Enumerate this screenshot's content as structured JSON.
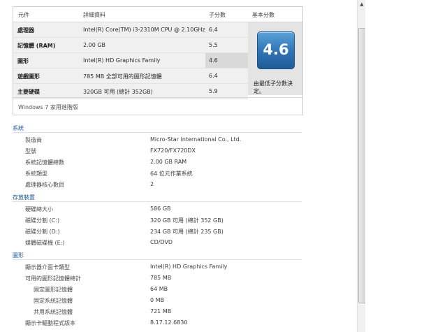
{
  "score_table": {
    "headers": {
      "component": "元件",
      "details": "詳細資料",
      "subscore": "子分數",
      "base_score": "基本分數"
    },
    "rows": [
      {
        "component": "處理器",
        "detail": "Intel(R) Core(TM) i3-2310M CPU @ 2.10GHz",
        "score": "6.4"
      },
      {
        "component": "記憶體 (RAM)",
        "detail": "2.00 GB",
        "score": "5.5"
      },
      {
        "component": "圖形",
        "detail": "Intel(R) HD Graphics Family",
        "score": "4.6"
      },
      {
        "component": "遊戲圖形",
        "detail": "785 MB 全部可用的圖形記憶體",
        "score": "6.4"
      },
      {
        "component": "主要硬碟",
        "detail": "320GB 可用 (總計 352GB)",
        "score": "5.9"
      }
    ],
    "base_score": "4.6",
    "base_note": "由最低子分數決定。",
    "edition": "Windows 7 家用進階版"
  },
  "sections": {
    "system": {
      "title": "系統",
      "rows": [
        {
          "label": "製造商",
          "value": "Micro-Star International Co., Ltd."
        },
        {
          "label": "型號",
          "value": "FX720/FX720DX"
        },
        {
          "label": "系統記憶體總數",
          "value": "2.00 GB RAM"
        },
        {
          "label": "系統類型",
          "value": "64 位元作業系統"
        },
        {
          "label": "處理器核心數目",
          "value": "2"
        }
      ]
    },
    "storage": {
      "title": "存放裝置",
      "rows": [
        {
          "label": "硬碟總大小",
          "value": "586 GB"
        },
        {
          "label": "磁碟分割 (C:)",
          "value": "320 GB 可用 (總計 352 GB)"
        },
        {
          "label": "磁碟分割 (D:)",
          "value": "234 GB 可用 (總計 235 GB)"
        },
        {
          "label": "媒體磁碟機 (E:)",
          "value": "CD/DVD"
        }
      ]
    },
    "graphics": {
      "title": "圖形",
      "rows": [
        {
          "label": "顯示器介面卡類型",
          "value": "Intel(R) HD Graphics Family"
        },
        {
          "label": "可用的圖形記憶體總計",
          "value": "785 MB"
        },
        {
          "label": "固定圖形記憶體",
          "value": "64 MB"
        },
        {
          "label": "固定系統記憶體",
          "value": "0 MB"
        },
        {
          "label": "共用系統記憶體",
          "value": "721 MB"
        },
        {
          "label": "顯示卡驅動程式版本",
          "value": "8.17.12.6830"
        }
      ]
    }
  },
  "scrollbar": {
    "up_arrow": "▲"
  }
}
